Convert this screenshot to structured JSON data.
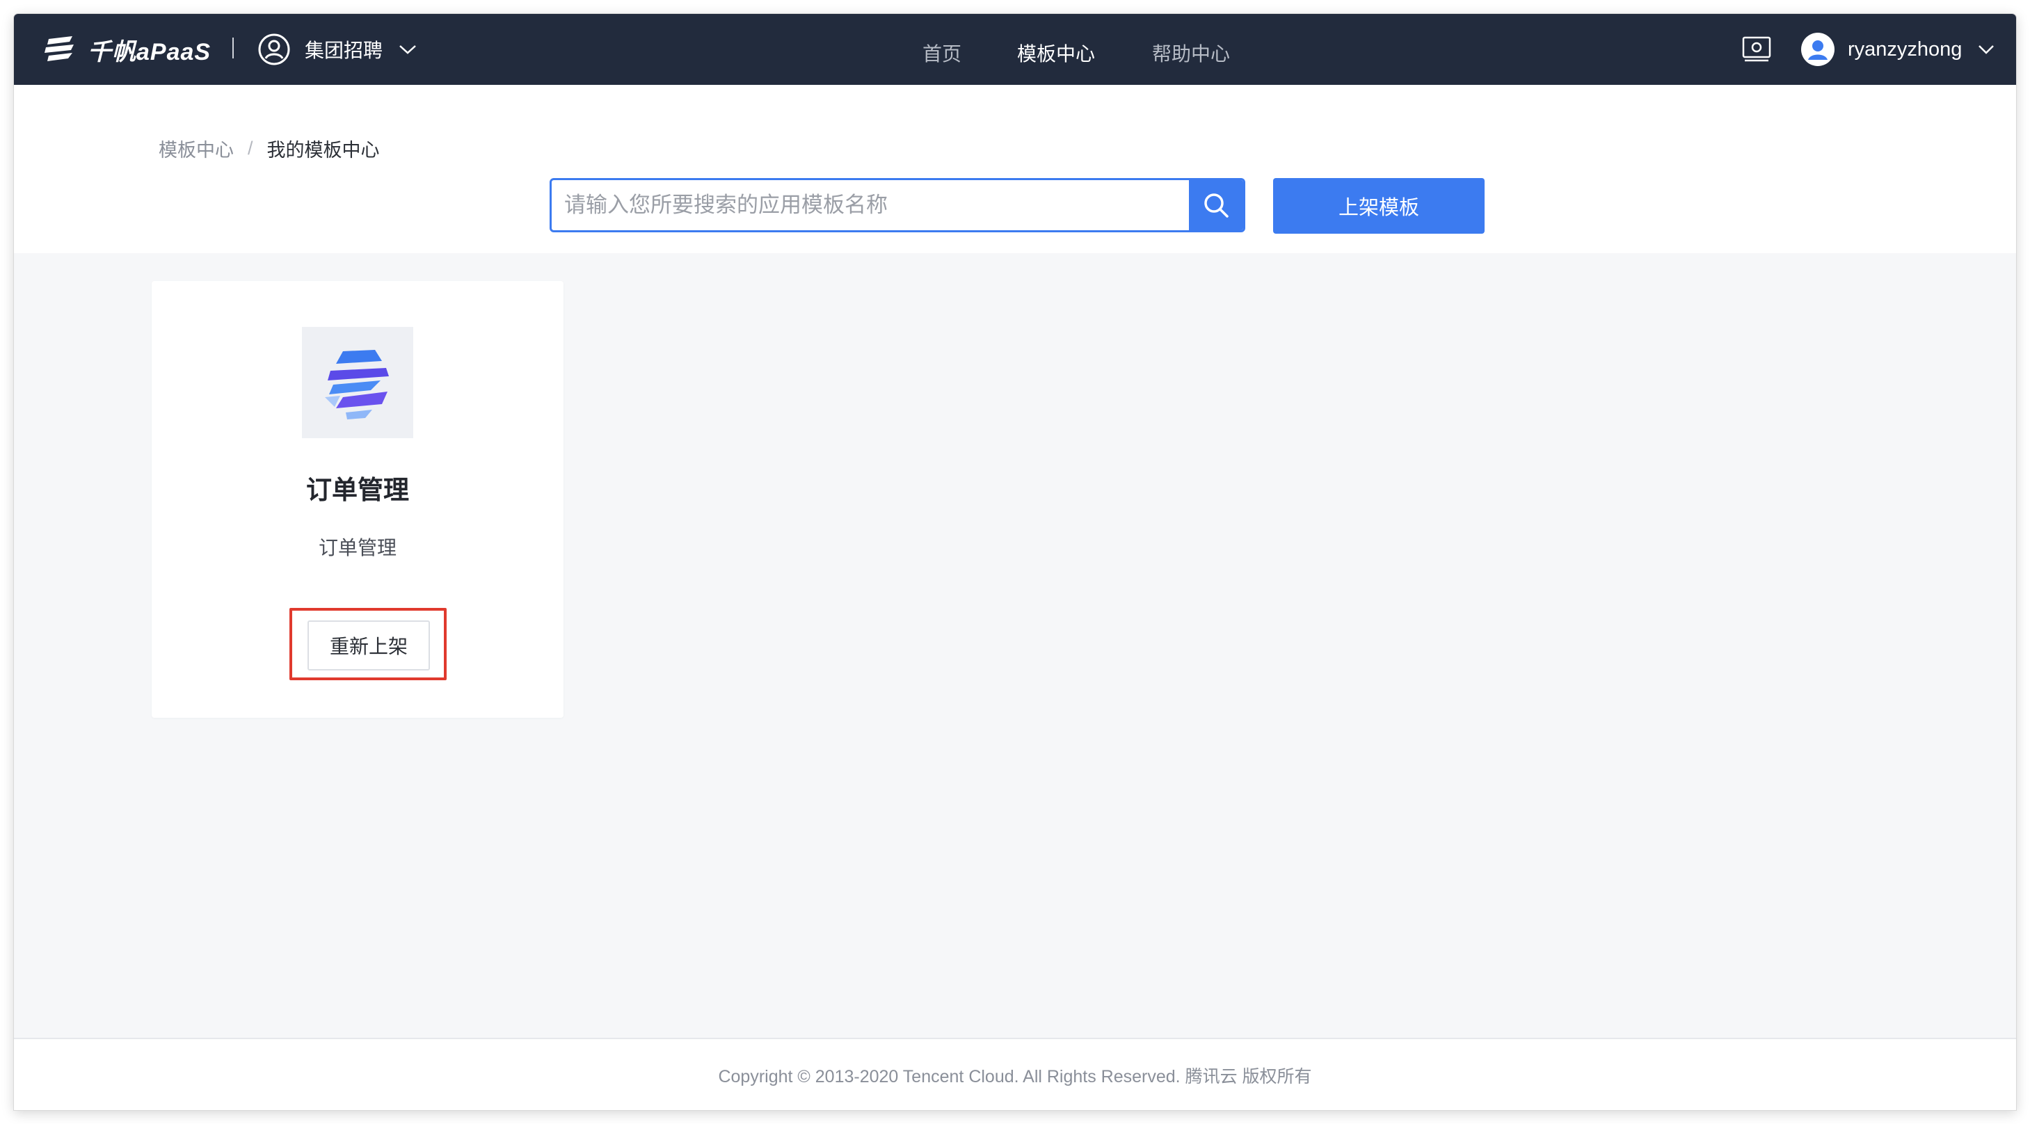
{
  "topbar": {
    "logo_text": "千帆aPaaS",
    "org_name": "集团招聘",
    "nav": [
      {
        "label": "首页",
        "active": false
      },
      {
        "label": "模板中心",
        "active": true
      },
      {
        "label": "帮助中心",
        "active": false
      }
    ],
    "user_name": "ryanzyzhong"
  },
  "breadcrumb": {
    "parent": "模板中心",
    "separator": "/",
    "current": "我的模板中心"
  },
  "search": {
    "placeholder": "请输入您所要搜索的应用模板名称",
    "value": ""
  },
  "publish_button": "上架模板",
  "templates": [
    {
      "title": "订单管理",
      "description": "订单管理",
      "action_label": "重新上架",
      "icon": "stripe-hexagon-icon"
    }
  ],
  "footer": {
    "copyright": "Copyright © 2013-2020 Tencent Cloud. All Rights Reserved. 腾讯云 版权所有"
  },
  "colors": {
    "topbar_bg": "#222b3d",
    "accent": "#3c7bf0",
    "highlight": "#e03a2e",
    "page_bg": "#f6f7f9"
  }
}
